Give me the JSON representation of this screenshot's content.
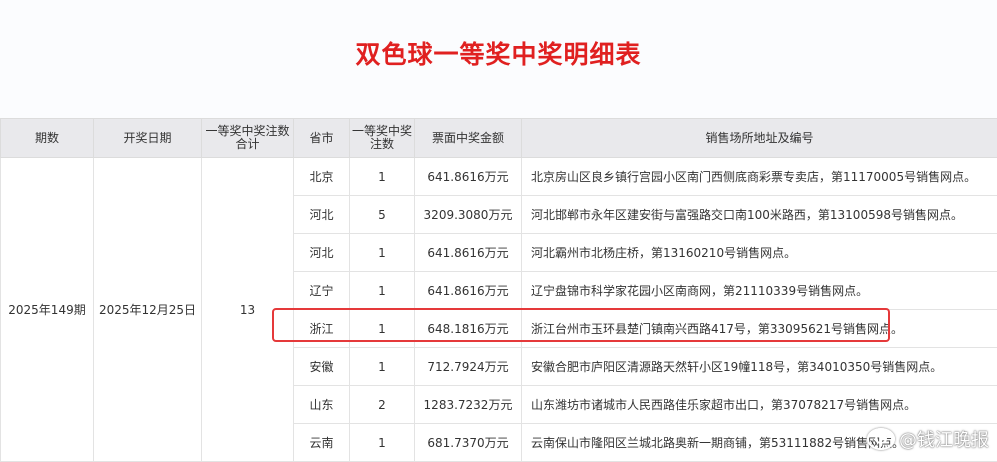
{
  "title": "双色球一等奖中奖明细表",
  "headers": {
    "period": "期数",
    "draw_date": "开奖日期",
    "total_count": "一等奖中奖注数合计",
    "province": "省市",
    "count": "一等奖中奖注数",
    "amount": "票面中奖金额",
    "address": "销售场所地址及编号"
  },
  "summary": {
    "period": "2025年149期",
    "draw_date": "2025年12月25日",
    "total_count": "13"
  },
  "rows": [
    {
      "province": "北京",
      "count": "1",
      "amount": "641.8616万元",
      "address": "北京房山区良乡镇行宫园小区南门西侧底商彩票专卖店，第11170005号销售网点。"
    },
    {
      "province": "河北",
      "count": "5",
      "amount": "3209.3080万元",
      "address": "河北邯郸市永年区建安街与富强路交口南100米路西，第13100598号销售网点。"
    },
    {
      "province": "河北",
      "count": "1",
      "amount": "641.8616万元",
      "address": "河北霸州市北杨庄桥，第13160210号销售网点。"
    },
    {
      "province": "辽宁",
      "count": "1",
      "amount": "641.8616万元",
      "address": "辽宁盘锦市科学家花园小区南商网，第21110339号销售网点。"
    },
    {
      "province": "浙江",
      "count": "1",
      "amount": "648.1816万元",
      "address": "浙江台州市玉环县楚门镇南兴西路417号，第33095621号销售网点。"
    },
    {
      "province": "安徽",
      "count": "1",
      "amount": "712.7924万元",
      "address": "安徽合肥市庐阳区清源路天然轩小区19幢118号，第34010350号销售网点。"
    },
    {
      "province": "山东",
      "count": "2",
      "amount": "1283.7232万元",
      "address": "山东潍坊市诸城市人民西路佳乐家超市出口，第37078217号销售网点。"
    },
    {
      "province": "云南",
      "count": "1",
      "amount": "681.7370万元",
      "address": "云南保山市隆阳区兰城北路奥新一期商铺，第53111882号销售网点。"
    }
  ],
  "watermark": "@钱江晚报",
  "colors": {
    "title": "#e02020",
    "highlight": "#e5393a",
    "header_bg": "#e9e9ec"
  }
}
